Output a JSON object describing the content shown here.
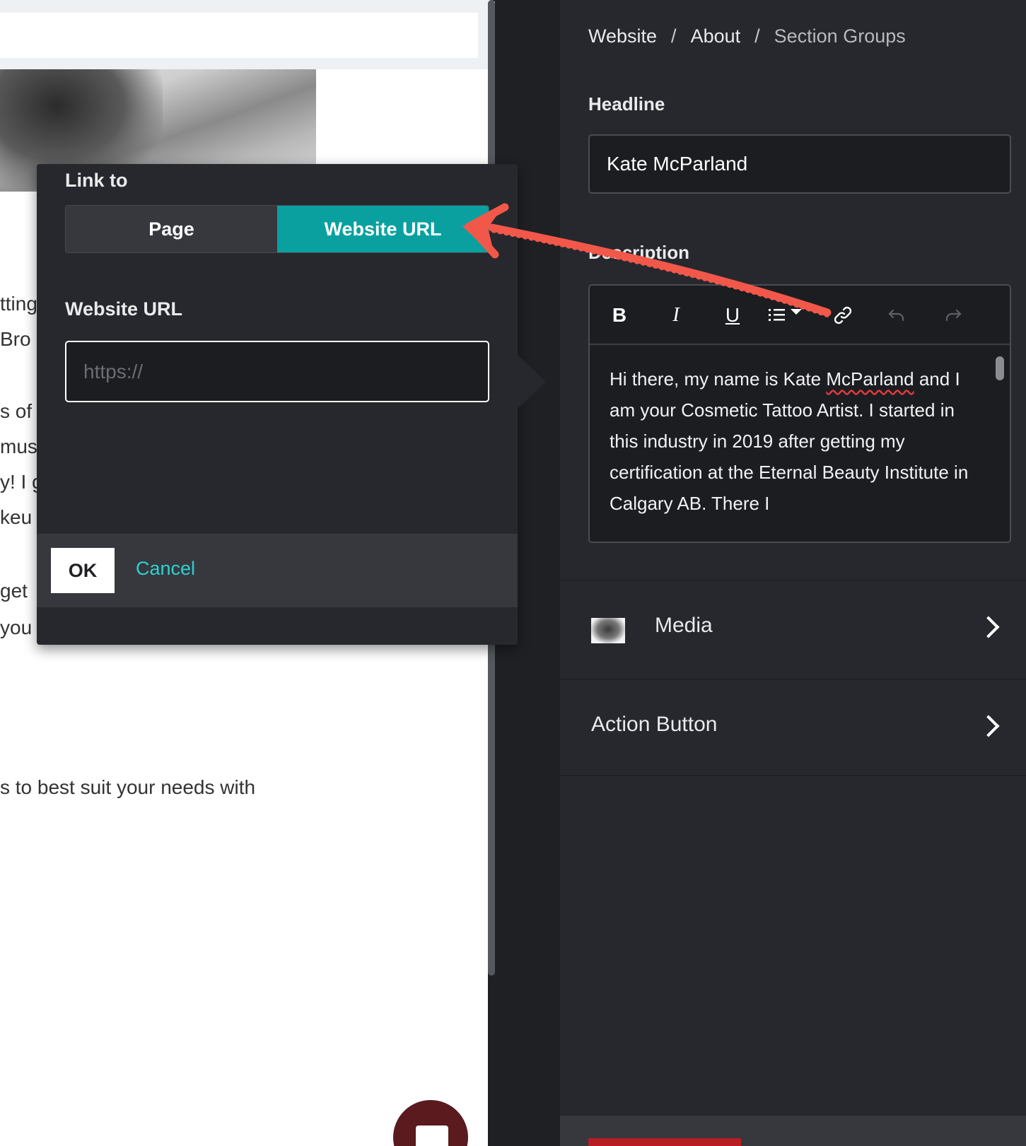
{
  "preview": {
    "fragments": [
      {
        "text": "tting",
        "top": 0
      },
      {
        "text": " Bro",
        "top": 0
      },
      {
        "text": "s of",
        "top": 0
      },
      {
        "text": "mus",
        "top": 0
      },
      {
        "text": "y! I g",
        "top": 0
      },
      {
        "text": "keu",
        "top": 0
      },
      {
        "text": " get",
        "top": 0
      },
      {
        "text": " you",
        "top": 0
      },
      {
        "text": "s to best suit your needs with",
        "top": 0
      }
    ]
  },
  "link_modal": {
    "title": "Link to",
    "tabs": [
      "Page",
      "Website URL"
    ],
    "active_tab": "Website URL",
    "url_label": "Website URL",
    "url_placeholder": "https://",
    "url_value": "",
    "ok_label": "OK",
    "cancel_label": "Cancel"
  },
  "panel": {
    "breadcrumb": [
      "Website",
      "About",
      "Section Groups"
    ],
    "headline_label": "Headline",
    "headline_value": "Kate McParland",
    "description_label": "Description",
    "toolbar": {
      "bold": "B",
      "italic": "I",
      "underline": "U",
      "list": "list-icon",
      "link": "link-icon",
      "undo": "undo-icon",
      "redo": "redo-icon"
    },
    "description_before": "Hi  there, my name is Kate ",
    "description_misspelled": "McParland",
    "description_after": " and I am your Cosmetic Tattoo Artist. I started in this industry in 2019 after getting my certification at the  Eternal Beauty Institute in Calgary AB. There I",
    "rows": {
      "media_label": "Media",
      "action_button_label": "Action Button"
    }
  },
  "colors": {
    "accent": "#0aa0a0",
    "cancel": "#2fd1cf",
    "annotation": "#f2584a",
    "publish": "#b81d22"
  }
}
